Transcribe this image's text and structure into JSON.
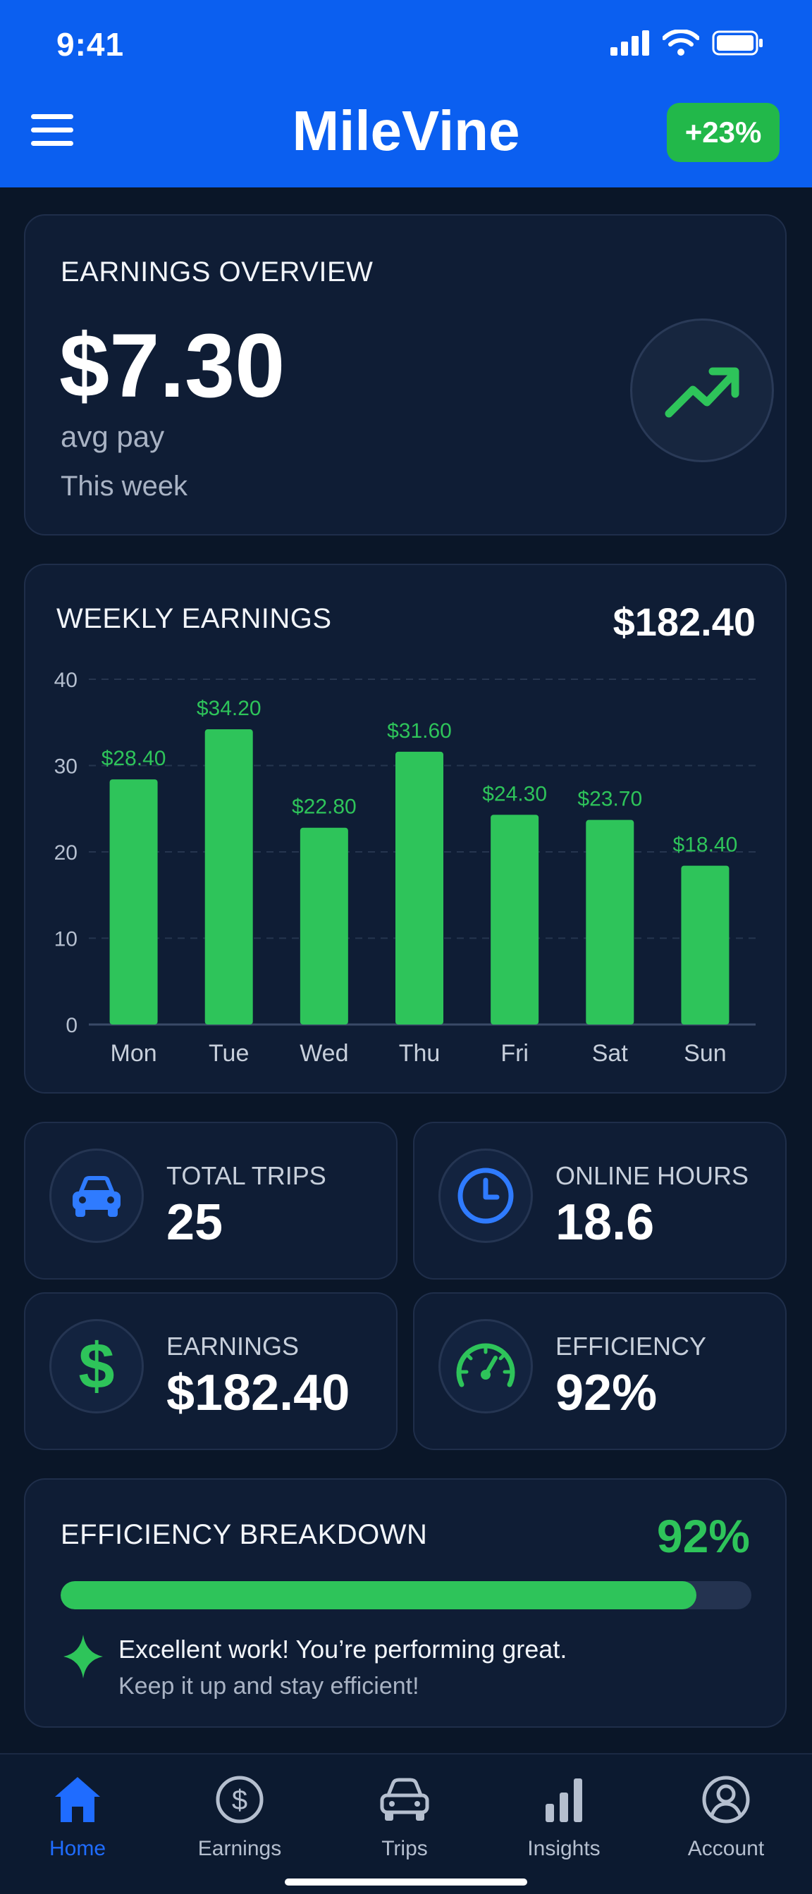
{
  "status_bar": {
    "time": "9:41"
  },
  "header": {
    "title": "MileVine",
    "badge": "+23%"
  },
  "overview": {
    "title": "EARNINGS OVERVIEW",
    "value": "$7.30",
    "subtitle": "avg pay",
    "period": "This week"
  },
  "weekly": {
    "title": "WEEKLY EARNINGS",
    "total": "$182.40"
  },
  "chart_data": {
    "type": "bar",
    "title": "WEEKLY EARNINGS",
    "categories": [
      "Mon",
      "Tue",
      "Wed",
      "Thu",
      "Fri",
      "Sat",
      "Sun"
    ],
    "values": [
      28.4,
      34.2,
      22.8,
      31.6,
      24.3,
      23.7,
      18.4
    ],
    "value_labels": [
      "$28.40",
      "$34.20",
      "$22.80",
      "$31.60",
      "$24.30",
      "$23.70",
      "$18.40"
    ],
    "yticks": [
      "0",
      "10",
      "20",
      "30",
      "40"
    ],
    "ylim": [
      0,
      40
    ],
    "grid": true,
    "bar_color": "#2ec45a"
  },
  "stats": [
    {
      "label": "TOTAL TRIPS",
      "value": "25",
      "icon": "car-icon"
    },
    {
      "label": "ONLINE HOURS",
      "value": "18.6",
      "icon": "clock-icon"
    },
    {
      "label": "EARNINGS",
      "value": "$182.40",
      "icon": "dollar-icon"
    },
    {
      "label": "EFFICIENCY",
      "value": "92%",
      "icon": "speedometer-icon"
    }
  ],
  "efficiency": {
    "title": "EFFICIENCY BREAKDOWN",
    "percent_label": "92%",
    "progress": 0.92,
    "message": "Excellent work! You’re performing great.",
    "submessage": "Keep it up and stay efficient!"
  },
  "nav": {
    "items": [
      {
        "label": "Home",
        "icon": "home-icon",
        "active": true
      },
      {
        "label": "Earnings",
        "icon": "dollar-circle-icon",
        "active": false
      },
      {
        "label": "Trips",
        "icon": "car-icon",
        "active": false
      },
      {
        "label": "Insights",
        "icon": "bar-chart-icon",
        "active": false
      },
      {
        "label": "Account",
        "icon": "user-circle-icon",
        "active": false
      }
    ]
  },
  "colors": {
    "accent": "#0b5ff0",
    "positive": "#2ec45a",
    "background": "#0a1628",
    "card": "#0f1d35"
  }
}
